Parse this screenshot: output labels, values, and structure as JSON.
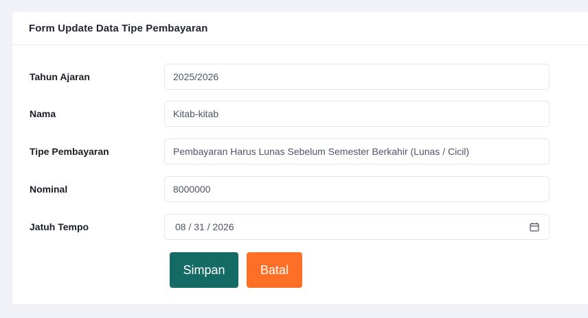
{
  "form": {
    "title": "Form Update Data Tipe Pembayaran",
    "fields": [
      {
        "label": "Tahun Ajaran",
        "value": "2025/2026"
      },
      {
        "label": "Nama",
        "value": "Kitab-kitab"
      },
      {
        "label": "Tipe Pembayaran",
        "value": "Pembayaran Harus Lunas Sebelum Semester Berkahir (Lunas / Cicil)"
      },
      {
        "label": "Nominal",
        "value": "8000000"
      },
      {
        "label": "Jatuh Tempo",
        "value": "08 / 31 / 2026",
        "icon": "calendar-icon"
      }
    ],
    "buttons": {
      "save_label": "Simpan",
      "cancel_label": "Batal"
    }
  },
  "colors": {
    "page_background": "#f1f2f7",
    "save_button": "#146b66",
    "cancel_button": "#fd6f27"
  }
}
